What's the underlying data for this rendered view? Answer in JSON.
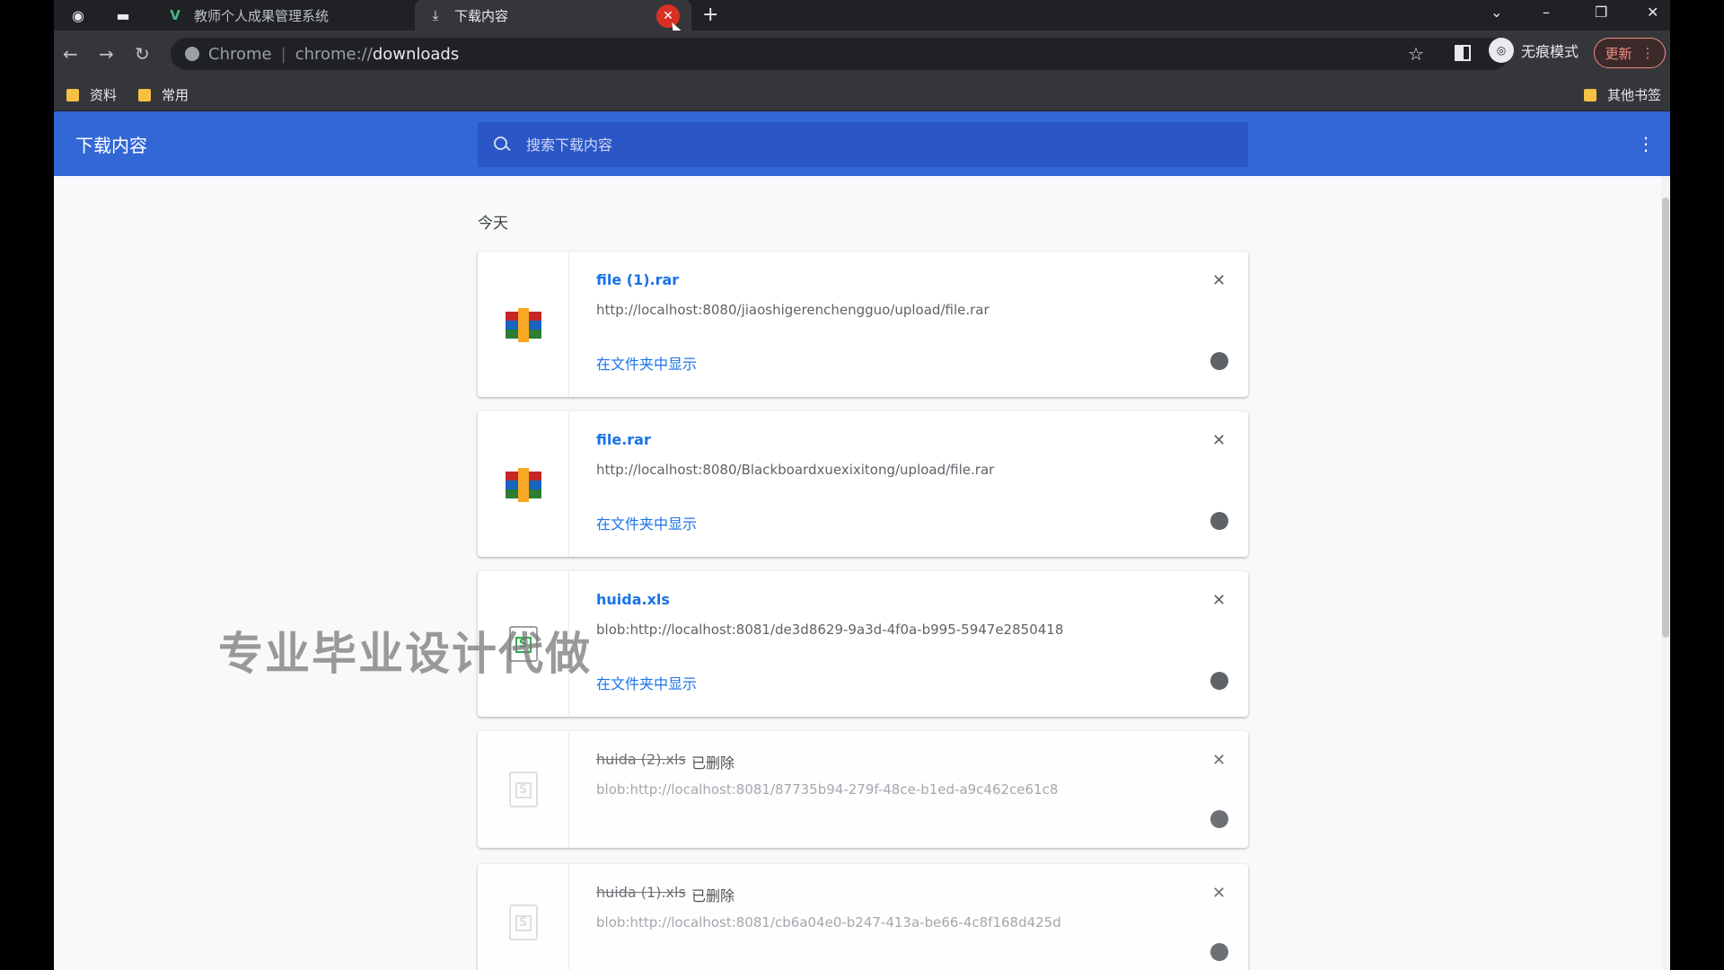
{
  "tabs": [
    {
      "title": "教师个人成果管理系统",
      "icon": "vue-logo-icon"
    },
    {
      "title": "下载内容",
      "icon": "download-icon"
    }
  ],
  "toolbar": {
    "site_label": "Chrome",
    "url_scheme": "chrome://",
    "url_path": "downloads",
    "incognito_label": "无痕模式",
    "update_label": "更新"
  },
  "bookmarks": {
    "items": [
      {
        "label": "资料"
      },
      {
        "label": "常用"
      }
    ],
    "other": "其他书签"
  },
  "downloads": {
    "title": "下载内容",
    "search_placeholder": "搜索下载内容",
    "date_label": "今天",
    "items": [
      {
        "filename": "file (1).rar",
        "url": "http://localhost:8080/jiaoshigerenchengguo/upload/file.rar",
        "action": "在文件夹中显示",
        "type": "rar",
        "deleted": false
      },
      {
        "filename": "file.rar",
        "url": "http://localhost:8080/Blackboardxuexixitong/upload/file.rar",
        "action": "在文件夹中显示",
        "type": "rar",
        "deleted": false
      },
      {
        "filename": "huida.xls",
        "url": "blob:http://localhost:8081/de3d8629-9a3d-4f0a-b995-5947e2850418",
        "action": "在文件夹中显示",
        "type": "xls",
        "deleted": false
      },
      {
        "filename": "huida (2).xls",
        "status": "已删除",
        "url": "blob:http://localhost:8081/87735b94-279f-48ce-b1ed-a9c462ce61c8",
        "type": "xls",
        "deleted": true
      },
      {
        "filename": "huida (1).xls",
        "status": "已删除",
        "url": "blob:http://localhost:8081/cb6a04e0-b247-413a-be66-4c8f168d425d",
        "type": "xls",
        "deleted": true
      }
    ]
  },
  "watermark": "专业毕业设计代做"
}
